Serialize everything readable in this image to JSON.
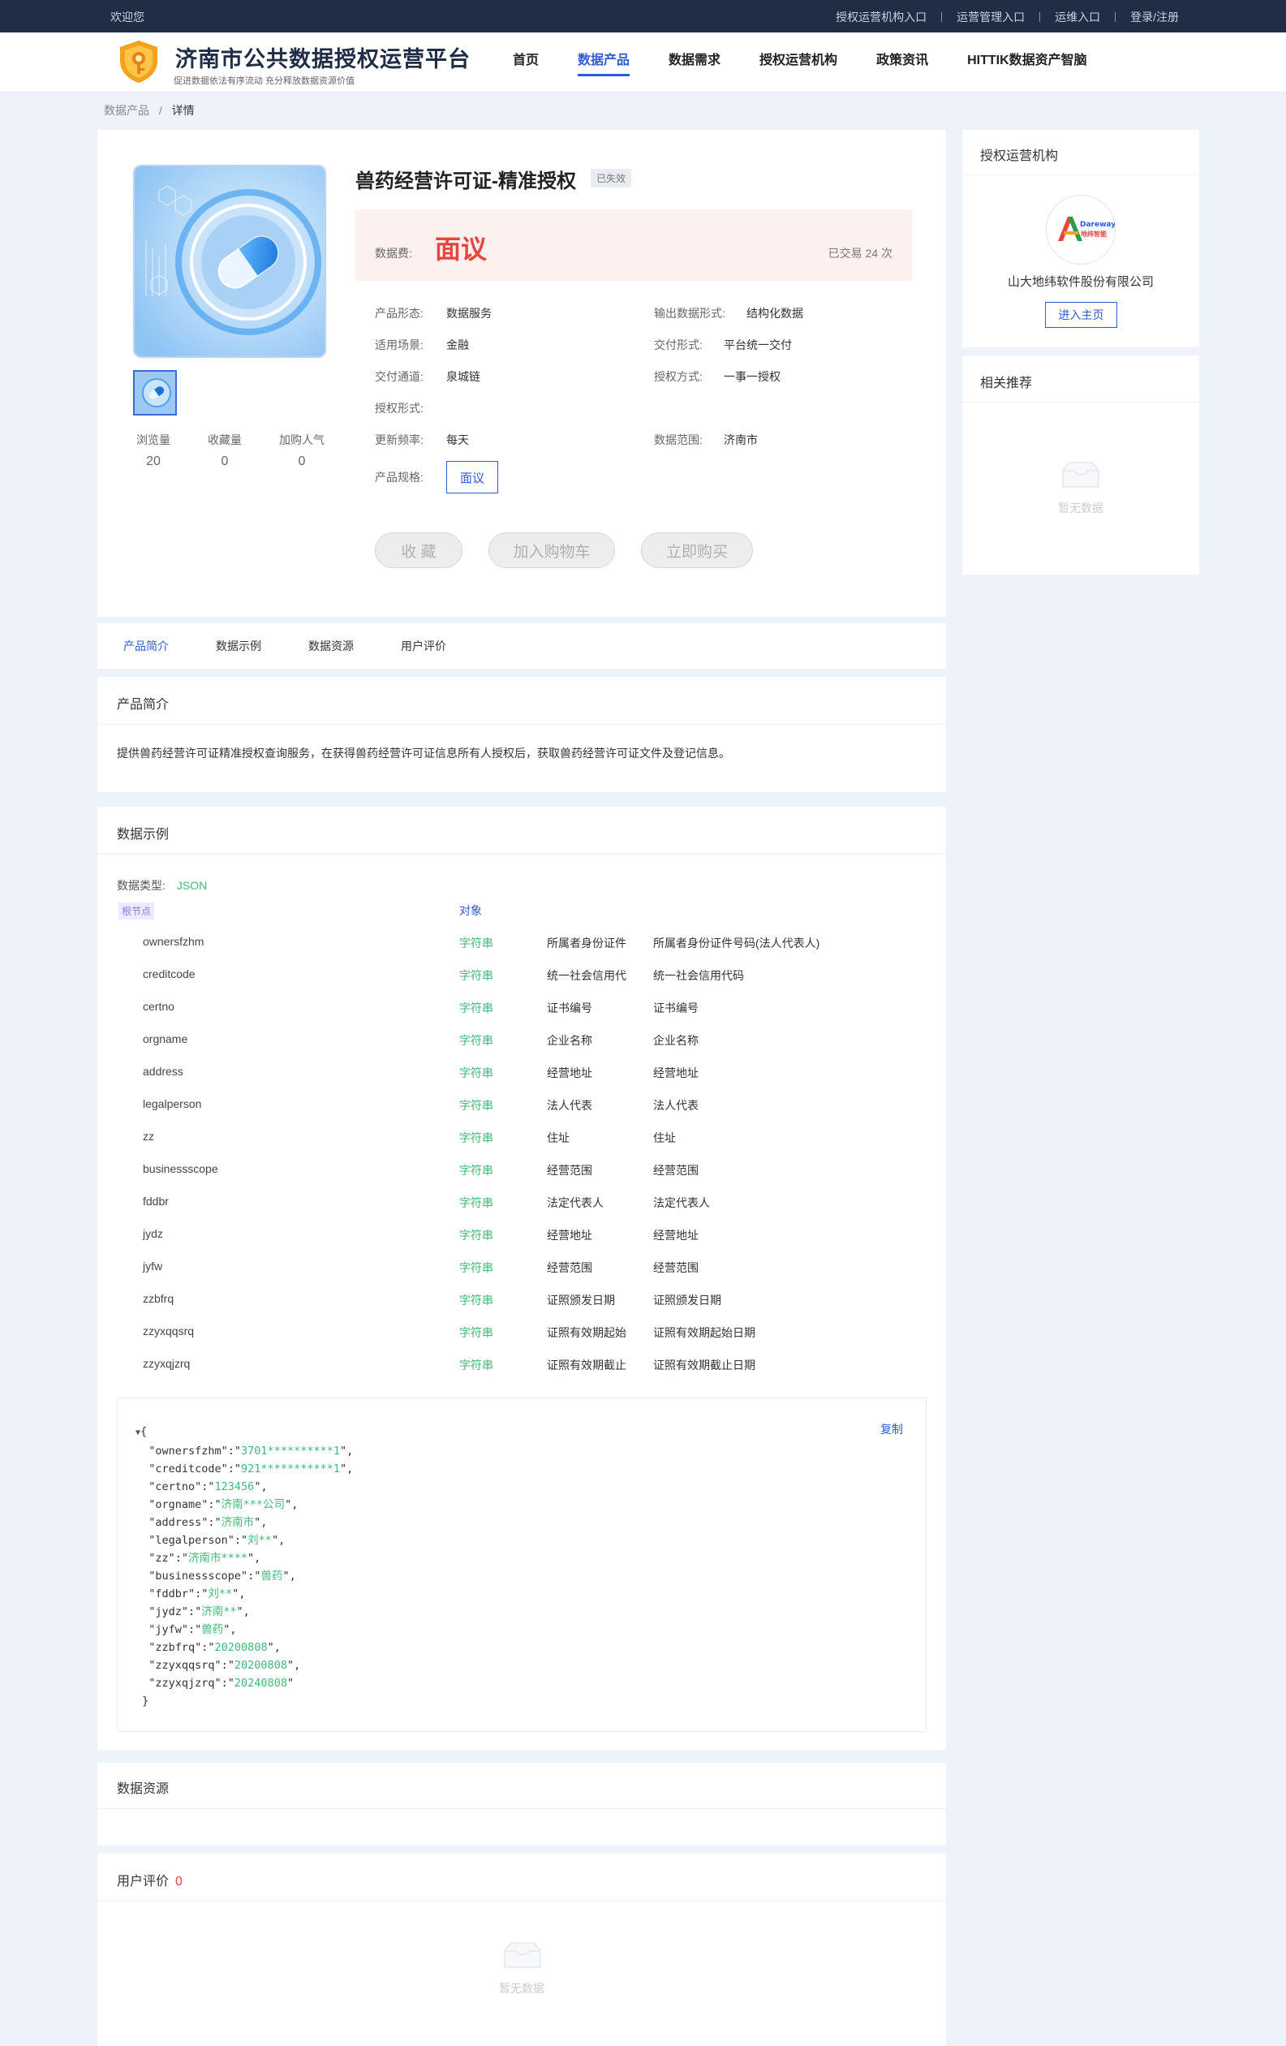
{
  "topbar": {
    "welcome": "欢迎您",
    "links": [
      "授权运营机构入口",
      "运营管理入口",
      "运维入口",
      "登录/注册"
    ]
  },
  "header": {
    "title": "济南市公共数据授权运营平台",
    "subtitle": "促进数据依法有序流动 充分释放数据资源价值",
    "nav": [
      "首页",
      "数据产品",
      "数据需求",
      "授权运营机构",
      "政策资讯",
      "HITTIK数据资产智脑"
    ],
    "active_nav": "数据产品"
  },
  "breadcrumb": {
    "parent": "数据产品",
    "sep": "/",
    "current": "详情"
  },
  "product": {
    "title": "兽药经营许可证-精准授权",
    "status": "已失效",
    "price_label": "数据费:",
    "price": "面议",
    "deals": "已交易 24 次",
    "stats": [
      {
        "label": "浏览量",
        "value": "20"
      },
      {
        "label": "收藏量",
        "value": "0"
      },
      {
        "label": "加购人气",
        "value": "0"
      }
    ],
    "attrs": {
      "form_k": "产品形态:",
      "form_v": "数据服务",
      "output_k": "输出数据形式:",
      "output_v": "结构化数据",
      "scene_k": "适用场景:",
      "scene_v": "金融",
      "delivery_k": "交付形式:",
      "delivery_v": "平台统一交付",
      "channel_k": "交付通道:",
      "channel_v": "泉城链",
      "auth_k": "授权方式:",
      "auth_v": "一事一授权",
      "authform_k": "授权形式:",
      "freq_k": "更新频率:",
      "freq_v": "每天",
      "range_k": "数据范围:",
      "range_v": "济南市",
      "spec_k": "产品规格:",
      "spec_v": "面议"
    },
    "buttons": {
      "favorite": "收 藏",
      "cart": "加入购物车",
      "buy": "立即购买"
    }
  },
  "sidebar": {
    "org_title": "授权运营机构",
    "org_logo_text": {
      "line1": "Dareway",
      "line2": "地纬智能"
    },
    "org_name": "山大地纬软件股份有限公司",
    "org_button": "进入主页",
    "recommend_title": "相关推荐",
    "empty": "暂无数据"
  },
  "tabs": [
    "产品简介",
    "数据示例",
    "数据资源",
    "用户评价"
  ],
  "intro": {
    "title": "产品简介",
    "text": "提供兽药经营许可证精准授权查询服务，在获得兽药经营许可证信息所有人授权后，获取兽药经营许可证文件及登记信息。"
  },
  "sample": {
    "title": "数据示例",
    "type_label": "数据类型:",
    "type_value": "JSON",
    "root_label": "根节点",
    "root_type": "对象",
    "fields": [
      {
        "name": "ownersfzhm",
        "type": "字符串",
        "cn": "所属者身份证件",
        "desc": "所属者身份证件号码(法人代表人)"
      },
      {
        "name": "creditcode",
        "type": "字符串",
        "cn": "统一社会信用代",
        "desc": "统一社会信用代码"
      },
      {
        "name": "certno",
        "type": "字符串",
        "cn": "证书编号",
        "desc": "证书编号"
      },
      {
        "name": "orgname",
        "type": "字符串",
        "cn": "企业名称",
        "desc": "企业名称"
      },
      {
        "name": "address",
        "type": "字符串",
        "cn": "经营地址",
        "desc": "经营地址"
      },
      {
        "name": "legalperson",
        "type": "字符串",
        "cn": "法人代表",
        "desc": "法人代表"
      },
      {
        "name": "zz",
        "type": "字符串",
        "cn": "住址",
        "desc": "住址"
      },
      {
        "name": "businessscope",
        "type": "字符串",
        "cn": "经营范围",
        "desc": "经营范围"
      },
      {
        "name": "fddbr",
        "type": "字符串",
        "cn": "法定代表人",
        "desc": "法定代表人"
      },
      {
        "name": "jydz",
        "type": "字符串",
        "cn": "经营地址",
        "desc": "经营地址"
      },
      {
        "name": "jyfw",
        "type": "字符串",
        "cn": "经营范围",
        "desc": "经营范围"
      },
      {
        "name": "zzbfrq",
        "type": "字符串",
        "cn": "证照颁发日期",
        "desc": "证照颁发日期"
      },
      {
        "name": "zzyxqqsrq",
        "type": "字符串",
        "cn": "证照有效期起始",
        "desc": "证照有效期起始日期"
      },
      {
        "name": "zzyxqjzrq",
        "type": "字符串",
        "cn": "证照有效期截止",
        "desc": "证照有效期截止日期"
      }
    ],
    "copy": "复制",
    "json_values": [
      {
        "key": "ownersfzhm",
        "value": "3701**********1"
      },
      {
        "key": "creditcode",
        "value": "921***********1"
      },
      {
        "key": "certno",
        "value": "123456"
      },
      {
        "key": "orgname",
        "value": "济南***公司"
      },
      {
        "key": "address",
        "value": "济南市"
      },
      {
        "key": "legalperson",
        "value": "刘**"
      },
      {
        "key": "zz",
        "value": "济南市****"
      },
      {
        "key": "businessscope",
        "value": "兽药"
      },
      {
        "key": "fddbr",
        "value": "刘**"
      },
      {
        "key": "jydz",
        "value": "济南**"
      },
      {
        "key": "jyfw",
        "value": "兽药"
      },
      {
        "key": "zzbfrq",
        "value": "20200808"
      },
      {
        "key": "zzyxqqsrq",
        "value": "20200808"
      },
      {
        "key": "zzyxqjzrq",
        "value": "20240808"
      }
    ]
  },
  "resources": {
    "title": "数据资源"
  },
  "reviews": {
    "title": "用户评价",
    "count": "0",
    "empty": "暂无数据"
  }
}
